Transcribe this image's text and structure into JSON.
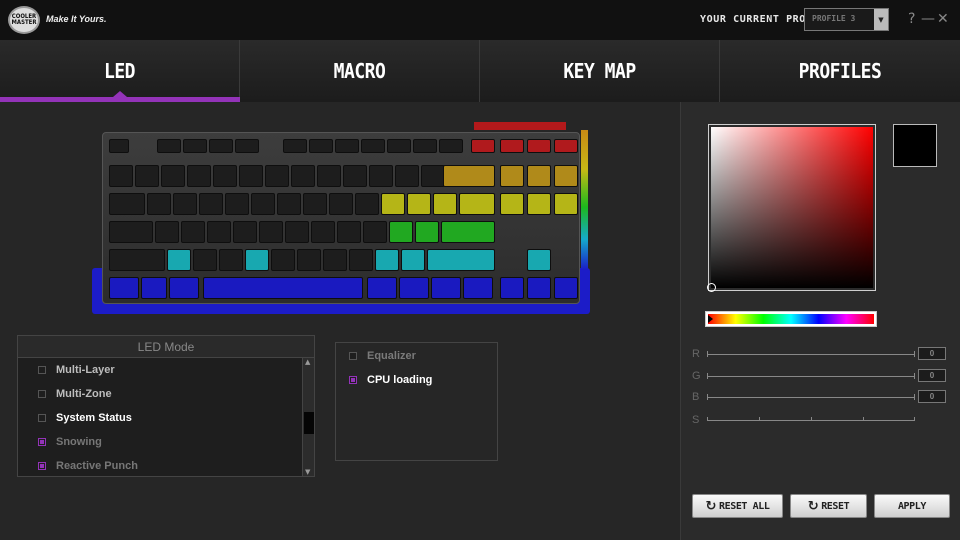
{
  "app": {
    "logo_text": "COOLER MASTER",
    "tagline": "Make It Yours."
  },
  "profile": {
    "label": "YOUR CURRENT PROFILE",
    "selected": "PROFILE 3"
  },
  "window": {
    "help": "?",
    "minimize": "—",
    "close": "✕"
  },
  "tabs": [
    {
      "label": "LED",
      "active": true
    },
    {
      "label": "MACRO",
      "active": false
    },
    {
      "label": "KEY MAP",
      "active": false
    },
    {
      "label": "PROFILES",
      "active": false
    }
  ],
  "keyboard": {
    "accent_colors": {
      "red": "#b01a1d",
      "orange": "#b08a1a",
      "yellow": "#b5b517",
      "green": "#21a821",
      "cyan": "#18a8b0",
      "blue": "#1a1ac0"
    }
  },
  "led_mode": {
    "title": "LED Mode",
    "items": [
      {
        "label": "Multi-Layer",
        "checked": false,
        "color": "#bdbdbd"
      },
      {
        "label": "Multi-Zone",
        "checked": false,
        "color": "#bdbdbd"
      },
      {
        "label": "System Status",
        "checked": false,
        "color": "#ffffff"
      },
      {
        "label": "Snowing",
        "checked": true,
        "color": "#777777"
      },
      {
        "label": "Reactive Punch",
        "checked": true,
        "color": "#777777"
      }
    ],
    "scroll_up": "▲",
    "scroll_down": "▼"
  },
  "sub_options": [
    {
      "label": "Equalizer",
      "checked": false,
      "color": "#7a7a7a"
    },
    {
      "label": "CPU loading",
      "checked": true,
      "color": "#ffffff"
    }
  ],
  "color_picker": {
    "selected_color": "#000000",
    "channels": [
      {
        "label": "R",
        "value": "0"
      },
      {
        "label": "G",
        "value": "0"
      },
      {
        "label": "B",
        "value": "0"
      },
      {
        "label": "S",
        "value": ""
      }
    ]
  },
  "buttons": {
    "reset_all": "RESET ALL",
    "reset": "RESET",
    "apply": "APPLY",
    "reset_icon": "↻"
  }
}
